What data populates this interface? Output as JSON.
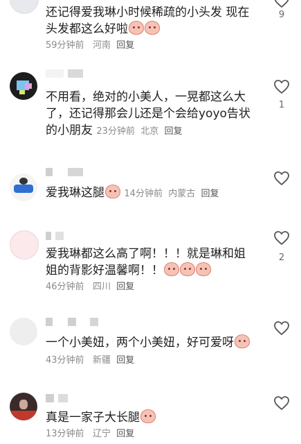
{
  "comments": [
    {
      "text": "还记得爱我琳小时候稀疏的小头发 现在头发都这么好啦",
      "emojis": 2,
      "time": "59分钟前",
      "location": "河南",
      "reply": "回复",
      "likes": "9"
    },
    {
      "text": "不用看，绝对的小美人，一晃都这么大了，还记得那会儿还是个会给yoyo告状的小朋友",
      "emojis": 0,
      "time": "23分钟前",
      "location": "北京",
      "reply": "回复",
      "likes": "1"
    },
    {
      "text": "爱我琳这腿",
      "emojis": 1,
      "time": "14分钟前",
      "location": "内蒙古",
      "reply": "回复",
      "likes": ""
    },
    {
      "text": "爱我琳都这么高了啊！！！就是琳和姐姐的背影好温馨啊！！",
      "emojis": 3,
      "time": "46分钟前",
      "location": "四川",
      "reply": "回复",
      "likes": "2"
    },
    {
      "text": "一个小美妞，两个小美妞，好可爱呀",
      "emojis": 1,
      "time": "43分钟前",
      "location": "新疆",
      "reply": "回复",
      "likes": ""
    },
    {
      "text": "真是一家子大长腿",
      "emojis": 1,
      "time": "13分钟前",
      "location": "辽宁",
      "reply": "回复",
      "likes": ""
    }
  ],
  "colors": {
    "text": "#1f1f1f",
    "meta": "#8a8a8a",
    "heart": "#555555"
  }
}
